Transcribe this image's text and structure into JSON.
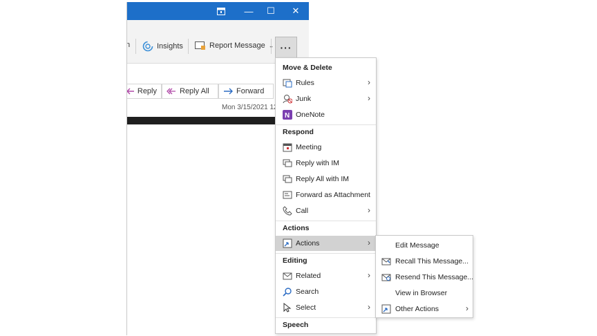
{
  "window": {
    "title_buttons": {
      "restore_icon": "window-mode-icon",
      "minimize": "—",
      "maximize": "☐",
      "close": "✕"
    }
  },
  "ribbon": {
    "partial_label": "n",
    "insights_label": "Insights",
    "report_label": "Report Message",
    "report_caret": "⌄",
    "more_label": "···",
    "collapse_caret": "⌄"
  },
  "message": {
    "reply_label": "Reply",
    "reply_all_label": "Reply All",
    "forward_label": "Forward",
    "date": "Mon 3/15/2021 12"
  },
  "menu": {
    "section_move_delete": "Move & Delete",
    "rules": "Rules",
    "junk": "Junk",
    "onenote": "OneNote",
    "section_respond": "Respond",
    "meeting": "Meeting",
    "reply_im": "Reply with IM",
    "reply_all_im": "Reply All with IM",
    "forward_attachment": "Forward as Attachment",
    "call": "Call",
    "section_actions": "Actions",
    "actions": "Actions",
    "section_editing": "Editing",
    "related": "Related",
    "search": "Search",
    "select": "Select",
    "section_speech": "Speech",
    "arrow": "›"
  },
  "submenu": {
    "edit_message": "Edit Message",
    "recall": "Recall This Message...",
    "resend": "Resend This Message...",
    "view_browser": "View in Browser",
    "other_actions": "Other Actions",
    "arrow": "›"
  },
  "colors": {
    "titlebar": "#1d6fc9",
    "accent": "#2b6cc4",
    "onenote": "#7b3fb0",
    "selected": "#d2d2d2"
  }
}
